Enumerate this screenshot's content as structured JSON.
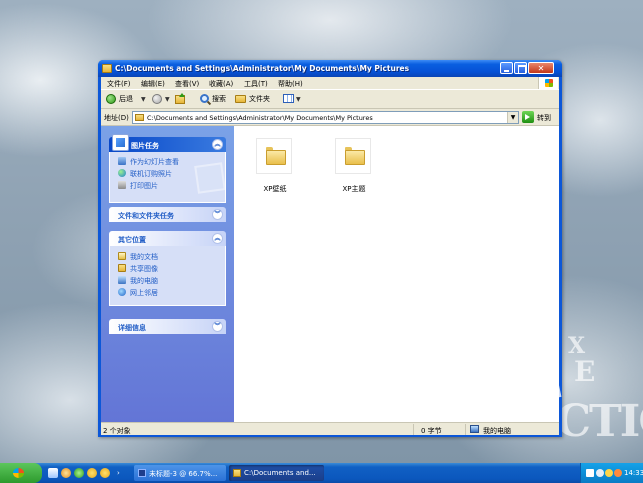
{
  "window": {
    "title": "C:\\Documents and Settings\\Administrator\\My Documents\\My Pictures",
    "menu": [
      "文件(F)",
      "编辑(E)",
      "查看(V)",
      "收藏(A)",
      "工具(T)",
      "帮助(H)"
    ],
    "toolbar": {
      "back": "后退",
      "search": "搜索",
      "folders": "文件夹"
    },
    "address": {
      "label": "地址(D)",
      "value": "C:\\Documents and Settings\\Administrator\\My Documents\\My Pictures",
      "go": "转到"
    }
  },
  "taskpane": {
    "picture_tasks": {
      "title": "图片任务",
      "items": [
        "作为幻灯片查看",
        "联机订购照片",
        "打印图片"
      ]
    },
    "file_tasks": {
      "title": "文件和文件夹任务"
    },
    "other_places": {
      "title": "其它位置",
      "items": [
        "我的文档",
        "共享图像",
        "我的电脑",
        "网上邻居"
      ]
    },
    "details": {
      "title": "详细信息"
    }
  },
  "files": [
    {
      "name": "XP壁纸"
    },
    {
      "name": "XP主题"
    }
  ],
  "status": {
    "objects": "2 个对象",
    "size": "0 字节",
    "location": "我的电脑"
  },
  "taskbar": {
    "photoshop_task": "未标题-3 @ 66.7%...",
    "explorer_task": "C:\\Documents and...",
    "clock": "14:33"
  },
  "desktop": {
    "wallpaper_text": [
      "X",
      "E",
      "CTIC"
    ]
  }
}
